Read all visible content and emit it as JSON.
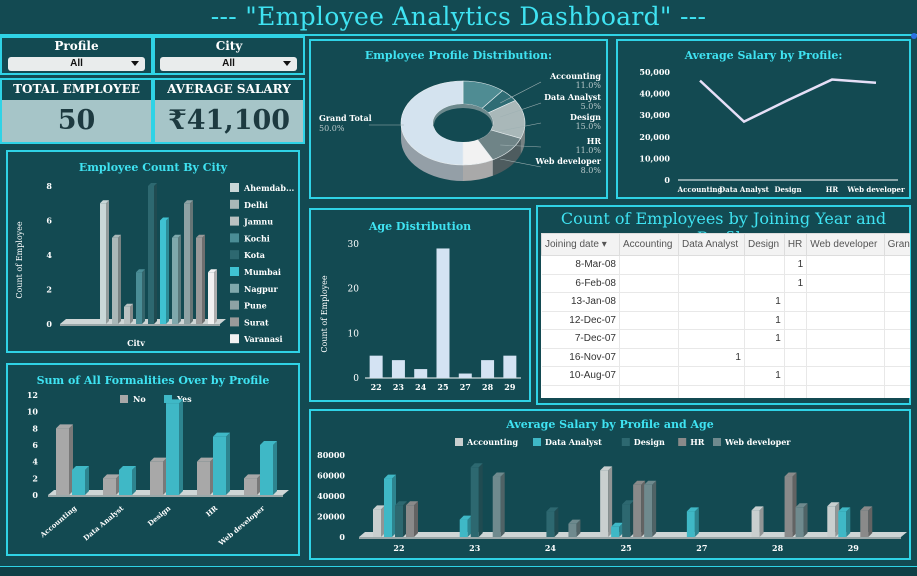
{
  "header": {
    "title": "--- \"Employee Analytics Dashboard\" ---"
  },
  "slicers": [
    {
      "label": "Profile",
      "value": "All"
    },
    {
      "label": "City",
      "value": "All"
    }
  ],
  "kpis": [
    {
      "label": "TOTAL EMPLOYEE",
      "value": "50"
    },
    {
      "label": "AVERAGE SALARY",
      "value": "₹41,100"
    }
  ],
  "colors": {
    "accent": "#3fe3f2",
    "background": "#134a52",
    "border": "#2fd3e6",
    "kpi_box": "#a6c5c8",
    "line": "#e6dff7"
  },
  "chart_data": [
    {
      "id": "employee-count-by-city",
      "type": "bar",
      "title": "Employee Count By City",
      "xlabel": "City",
      "ylabel": "Count of Employee",
      "ylim": [
        0,
        8
      ],
      "yticks": [
        0,
        2,
        4,
        6,
        8
      ],
      "series": [
        {
          "name": "Ahemdab...",
          "value": 7,
          "color": "#c9d7d7"
        },
        {
          "name": "Delhi",
          "value": 5,
          "color": "#aab8b8"
        },
        {
          "name": "Jamnu",
          "value": 1,
          "color": "#b9c1c1"
        },
        {
          "name": "Kochi",
          "value": 3,
          "color": "#4a8d96"
        },
        {
          "name": "Kota",
          "value": 8,
          "color": "#2d6870"
        },
        {
          "name": "Mumbai",
          "value": 6,
          "color": "#3fc2d2"
        },
        {
          "name": "Nagpur",
          "value": 5,
          "color": "#7fa8ac"
        },
        {
          "name": "Pune",
          "value": 7,
          "color": "#8ea2a4"
        },
        {
          "name": "Surat",
          "value": 5,
          "color": "#9a9a9a"
        },
        {
          "name": "Varanasi",
          "value": 3,
          "color": "#f2f2f2"
        }
      ],
      "legend": "right"
    },
    {
      "id": "employee-profile-distribution",
      "type": "pie",
      "title": "Employee Profile Distribution:",
      "slices": [
        {
          "label": "Accounting",
          "percent": "11.0%",
          "value": 11,
          "color": "#4f8c93"
        },
        {
          "label": "Data Analyst",
          "percent": "5.0%",
          "value": 5,
          "color": "#2f6c74"
        },
        {
          "label": "Design",
          "percent": "15.0%",
          "value": 15,
          "color": "#a9b8b9"
        },
        {
          "label": "HR",
          "percent": "11.0%",
          "value": 11,
          "color": "#6f8487"
        },
        {
          "label": "Web developer",
          "percent": "8.0%",
          "value": 8,
          "color": "#f2f2f2"
        },
        {
          "label": "Grand Total",
          "percent": "50.0%",
          "value": 50,
          "color": "#d4e3ef"
        }
      ]
    },
    {
      "id": "average-salary-by-profile",
      "type": "line",
      "title": "Average Salary by Profile:",
      "categories": [
        "Accounting",
        "Data Analyst",
        "Design",
        "HR",
        "Web developer"
      ],
      "values": [
        46000,
        27000,
        37000,
        46500,
        45000
      ],
      "ylim": [
        0,
        50000
      ],
      "yticks": [
        "0",
        "10,000",
        "20,000",
        "30,000",
        "40,000",
        "50,000"
      ]
    },
    {
      "id": "age-distribution",
      "type": "bar",
      "title": "Age Distribution",
      "ylabel": "Count of Employee",
      "categories": [
        "22",
        "23",
        "24",
        "25",
        "27",
        "28",
        "29"
      ],
      "values": [
        5,
        4,
        2,
        29,
        1,
        4,
        5
      ],
      "ylim": [
        0,
        30
      ],
      "yticks": [
        0,
        10,
        20,
        30
      ]
    },
    {
      "id": "formalities-by-profile",
      "type": "bar",
      "title": "Sum of All Formalities Over by Profile",
      "categories": [
        "Accounting",
        "Data Analyst",
        "Design",
        "HR",
        "Web developer"
      ],
      "series": [
        {
          "name": "No",
          "values": [
            8,
            2,
            4,
            4,
            2
          ],
          "color": "#a8a8a8"
        },
        {
          "name": "Yes",
          "values": [
            3,
            3,
            11,
            7,
            6
          ],
          "color": "#3fb8c6"
        }
      ],
      "ylim": [
        0,
        12
      ],
      "yticks": [
        0,
        2,
        4,
        6,
        8,
        10,
        12
      ],
      "legend": "top"
    },
    {
      "id": "average-salary-by-profile-and-age",
      "type": "bar",
      "title": "Average Salary by Profile and Age",
      "categories": [
        "22",
        "23",
        "24",
        "25",
        "27",
        "28",
        "29"
      ],
      "series": [
        {
          "name": "Accounting",
          "values": [
            27000,
            null,
            null,
            65000,
            null,
            26000,
            30000
          ],
          "color": "#c9cfcf"
        },
        {
          "name": "Data Analyst",
          "values": [
            57000,
            17000,
            null,
            10000,
            25000,
            null,
            25000
          ],
          "color": "#3fb8c6"
        },
        {
          "name": "Design",
          "values": [
            31000,
            68000,
            25000,
            32000,
            null,
            null,
            null
          ],
          "color": "#2d6870"
        },
        {
          "name": "HR",
          "values": [
            31000,
            null,
            null,
            51000,
            null,
            59000,
            26000
          ],
          "color": "#8a8a8a"
        },
        {
          "name": "Web developer",
          "values": [
            null,
            59000,
            13000,
            51000,
            null,
            29000,
            null
          ],
          "color": "#6f8a8e"
        }
      ],
      "ylim": [
        0,
        80000
      ],
      "yticks": [
        "0",
        "20000",
        "40000",
        "60000",
        "80000"
      ],
      "legend": "top"
    }
  ],
  "joining_table": {
    "title": "Count of Employees by Joining Year and Profile",
    "columns": [
      "Joining date",
      "Accounting",
      "Data Analyst",
      "Design",
      "HR",
      "Web developer",
      "Grand"
    ],
    "rows": [
      {
        "date": "8-Mar-08",
        "cells": [
          "",
          "",
          "",
          "1",
          "",
          ""
        ]
      },
      {
        "date": "6-Feb-08",
        "cells": [
          "",
          "",
          "",
          "1",
          "",
          ""
        ]
      },
      {
        "date": "13-Jan-08",
        "cells": [
          "",
          "",
          "1",
          "",
          "",
          ""
        ]
      },
      {
        "date": "12-Dec-07",
        "cells": [
          "",
          "",
          "1",
          "",
          "",
          ""
        ]
      },
      {
        "date": "7-Dec-07",
        "cells": [
          "",
          "",
          "1",
          "",
          "",
          ""
        ]
      },
      {
        "date": "16-Nov-07",
        "cells": [
          "",
          "1",
          "",
          "",
          "",
          ""
        ]
      },
      {
        "date": "10-Aug-07",
        "cells": [
          "",
          "",
          "1",
          "",
          "",
          ""
        ]
      }
    ]
  }
}
